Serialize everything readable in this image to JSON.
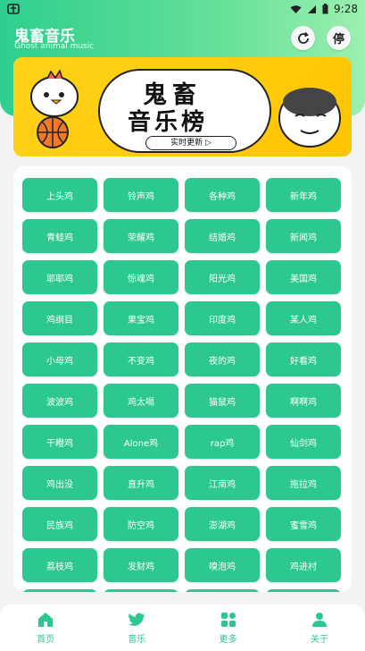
{
  "status_bar": {
    "left_icon": "app-icon",
    "time": "9:28"
  },
  "header": {
    "title": "鬼畜音乐",
    "subtitle": "Ghost animal music",
    "refresh_icon": "refresh-icon",
    "stop_label": "停"
  },
  "banner": {
    "line1": "鬼畜",
    "line2": "音乐榜",
    "tag": "实时更新 ▷"
  },
  "grid_items": [
    "上头鸡",
    "铃声鸡",
    "各种鸡",
    "新年鸡",
    "青蛙鸡",
    "荣耀鸡",
    "结婚鸡",
    "新闻鸡",
    "耶耶鸡",
    "惊魂鸡",
    "阳光鸡",
    "美国鸡",
    "鸡纲目",
    "果宝鸡",
    "印度鸡",
    "某人鸡",
    "小母鸡",
    "不变鸡",
    "夜的鸡",
    "好看鸡",
    "波波鸡",
    "鸡太嗝",
    "猫鼠鸡",
    "啊啊鸡",
    "干瞪鸡",
    "Alone鸡",
    "rap鸡",
    "仙剑鸡",
    "鸡出没",
    "直升鸡",
    "江南鸡",
    "拖拉鸡",
    "民族鸡",
    "防空鸡",
    "澎湖鸡",
    "蜜雪鸡",
    "荔枝鸡",
    "发财鸡",
    "嗅泡鸡",
    "鸡进村",
    "",
    "",
    "",
    ""
  ],
  "tabs": [
    {
      "label": "首页",
      "icon": "home-icon"
    },
    {
      "label": "音乐",
      "icon": "bird-icon"
    },
    {
      "label": "更多",
      "icon": "apps-icon"
    },
    {
      "label": "关于",
      "icon": "person-icon"
    }
  ],
  "colors": {
    "accent": "#2cc88f",
    "banner": "#ffc400"
  }
}
